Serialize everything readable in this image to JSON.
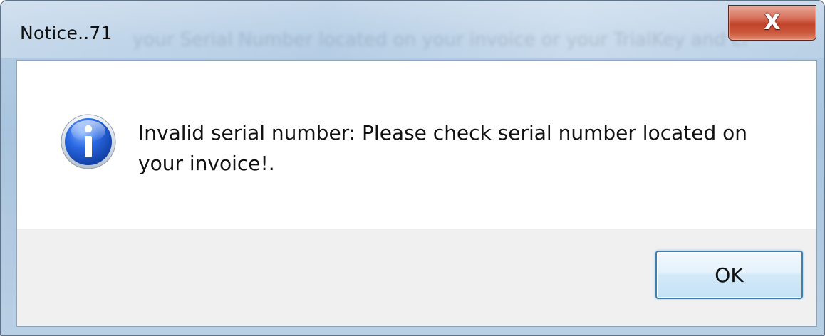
{
  "dialog": {
    "title": "Notice..71",
    "close_label": "X",
    "background_text": "your Serial Number located on your invoice or your TrialKey and click",
    "icon": "info-icon",
    "message_line1": "Invalid serial number:  Please check serial number located on",
    "message_line2": "your invoice!.",
    "ok_label": "OK"
  },
  "colors": {
    "close_button": "#c2432a",
    "info_icon": "#1d5bd8",
    "ok_border": "#3c7fb1",
    "frame": "#b3cce4"
  }
}
